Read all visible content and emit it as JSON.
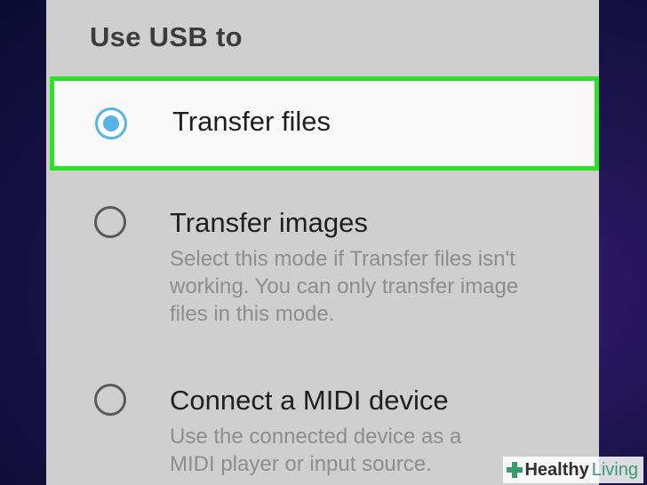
{
  "dialog": {
    "title": "Use USB to",
    "options": [
      {
        "label": "Transfer files",
        "description": "",
        "selected": true
      },
      {
        "label": "Transfer images",
        "description": "Select this mode if Transfer files isn't working. You can only transfer image files in this mode.",
        "selected": false
      },
      {
        "label": "Connect a MIDI device",
        "description": "Use the connected device as a MIDI player or input source.",
        "selected": false
      }
    ]
  },
  "watermark": {
    "part1": "Healthy",
    "part2": "Living"
  },
  "colors": {
    "highlight_border": "#2de02a",
    "radio_accent": "#55b3e6",
    "dialog_bg": "#cfcfcf"
  },
  "icons": {
    "selected_radio": "radio-checked-icon",
    "unselected_radio": "radio-unchecked-icon",
    "watermark": "plus-cross-icon"
  }
}
